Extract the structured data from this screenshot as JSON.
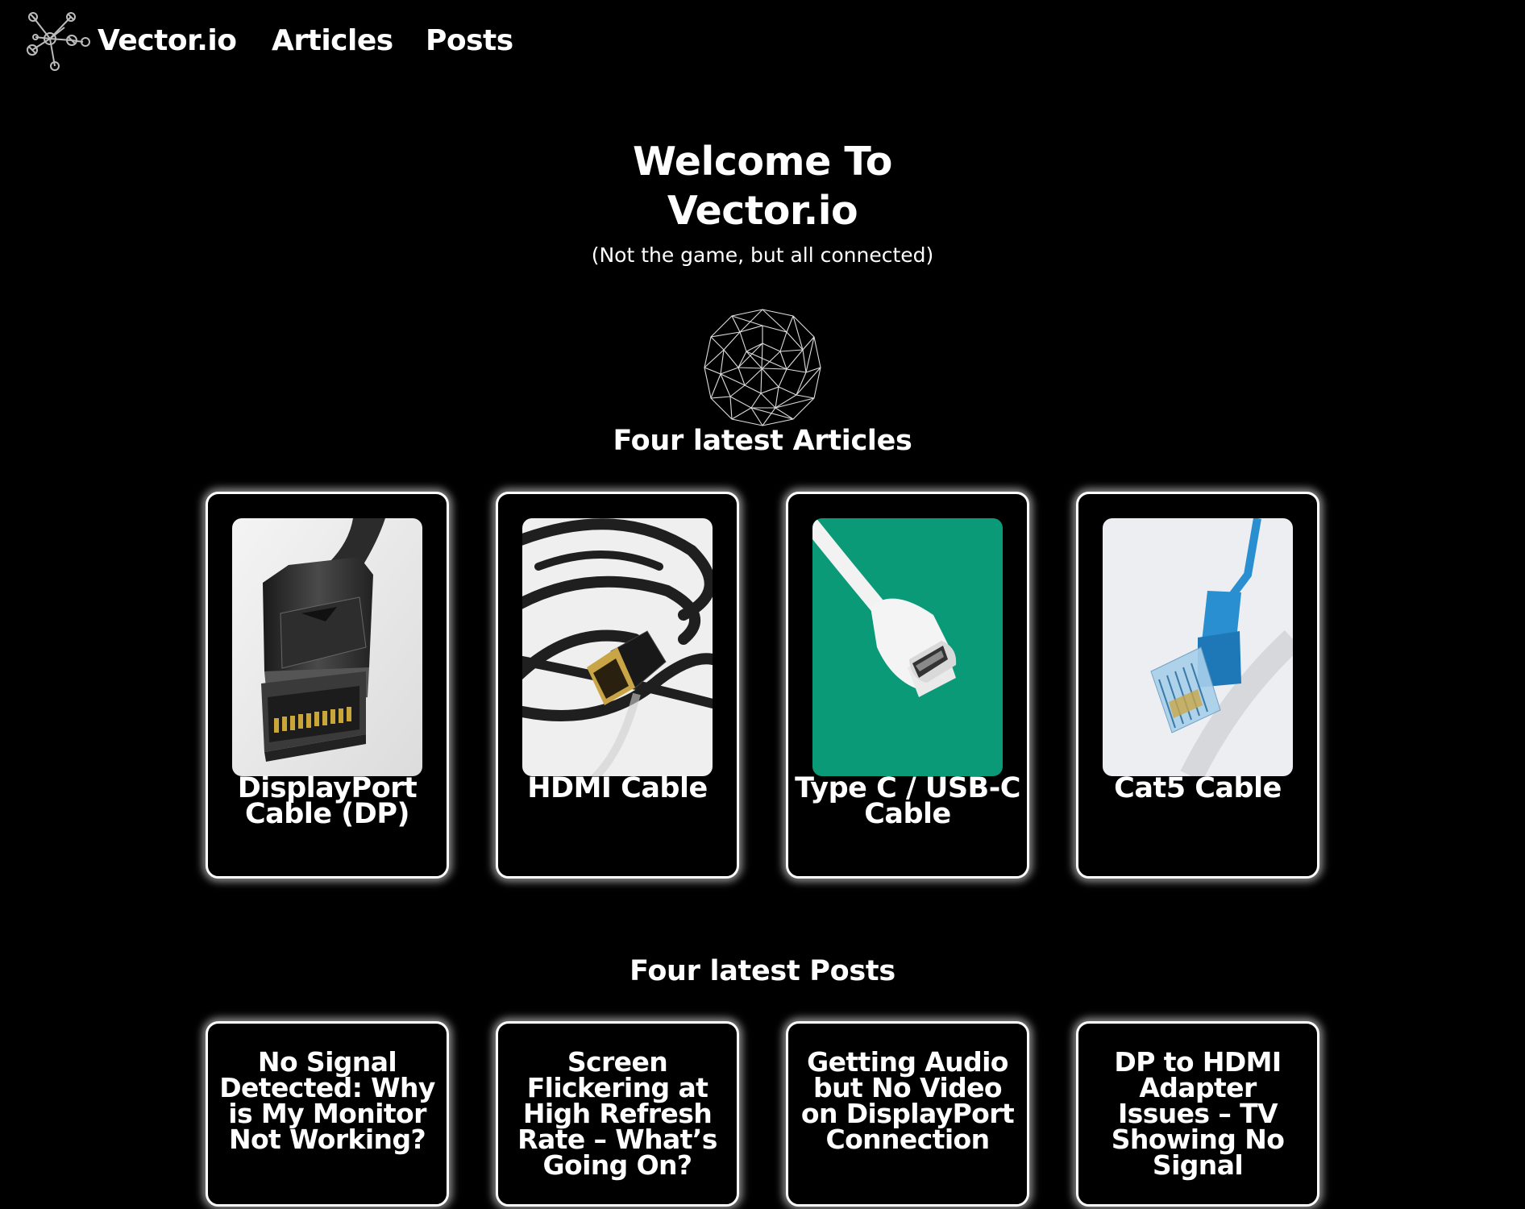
{
  "nav": {
    "brand": "Vector.io",
    "links": [
      {
        "label": "Articles"
      },
      {
        "label": "Posts"
      }
    ],
    "logo_icon": "network-nodes-icon"
  },
  "hero": {
    "title_line1": "Welcome To",
    "title_line2": "Vector.io",
    "subtitle": "(Not the game, but all connected)",
    "graphic": "wireframe-sphere-icon"
  },
  "articles": {
    "heading": "Four latest Articles",
    "items": [
      {
        "title": "DisplayPort Cable (DP)",
        "image": "displayport-connector-photo"
      },
      {
        "title": "HDMI Cable",
        "image": "hdmi-cable-photo"
      },
      {
        "title": "Type C / USB-C Cable",
        "image": "usb-c-cable-photo"
      },
      {
        "title": "Cat5 Cable",
        "image": "cat5-ethernet-cable-photo"
      }
    ]
  },
  "posts": {
    "heading": "Four latest Posts",
    "items": [
      {
        "title": "No Signal Detected: Why is My Monitor Not Working?"
      },
      {
        "title": "Screen Flickering at High Refresh Rate – What’s Going On?"
      },
      {
        "title": "Getting Audio but No Video on DisplayPort Connection"
      },
      {
        "title": "DP to HDMI Adapter Issues – TV Showing No Signal"
      }
    ]
  },
  "colors": {
    "background": "#000000",
    "text": "#ffffff",
    "card_border": "#ffffff",
    "usb_c_photo_bg": "#0a9a78",
    "cat5_cable": "#2a8fd0"
  }
}
